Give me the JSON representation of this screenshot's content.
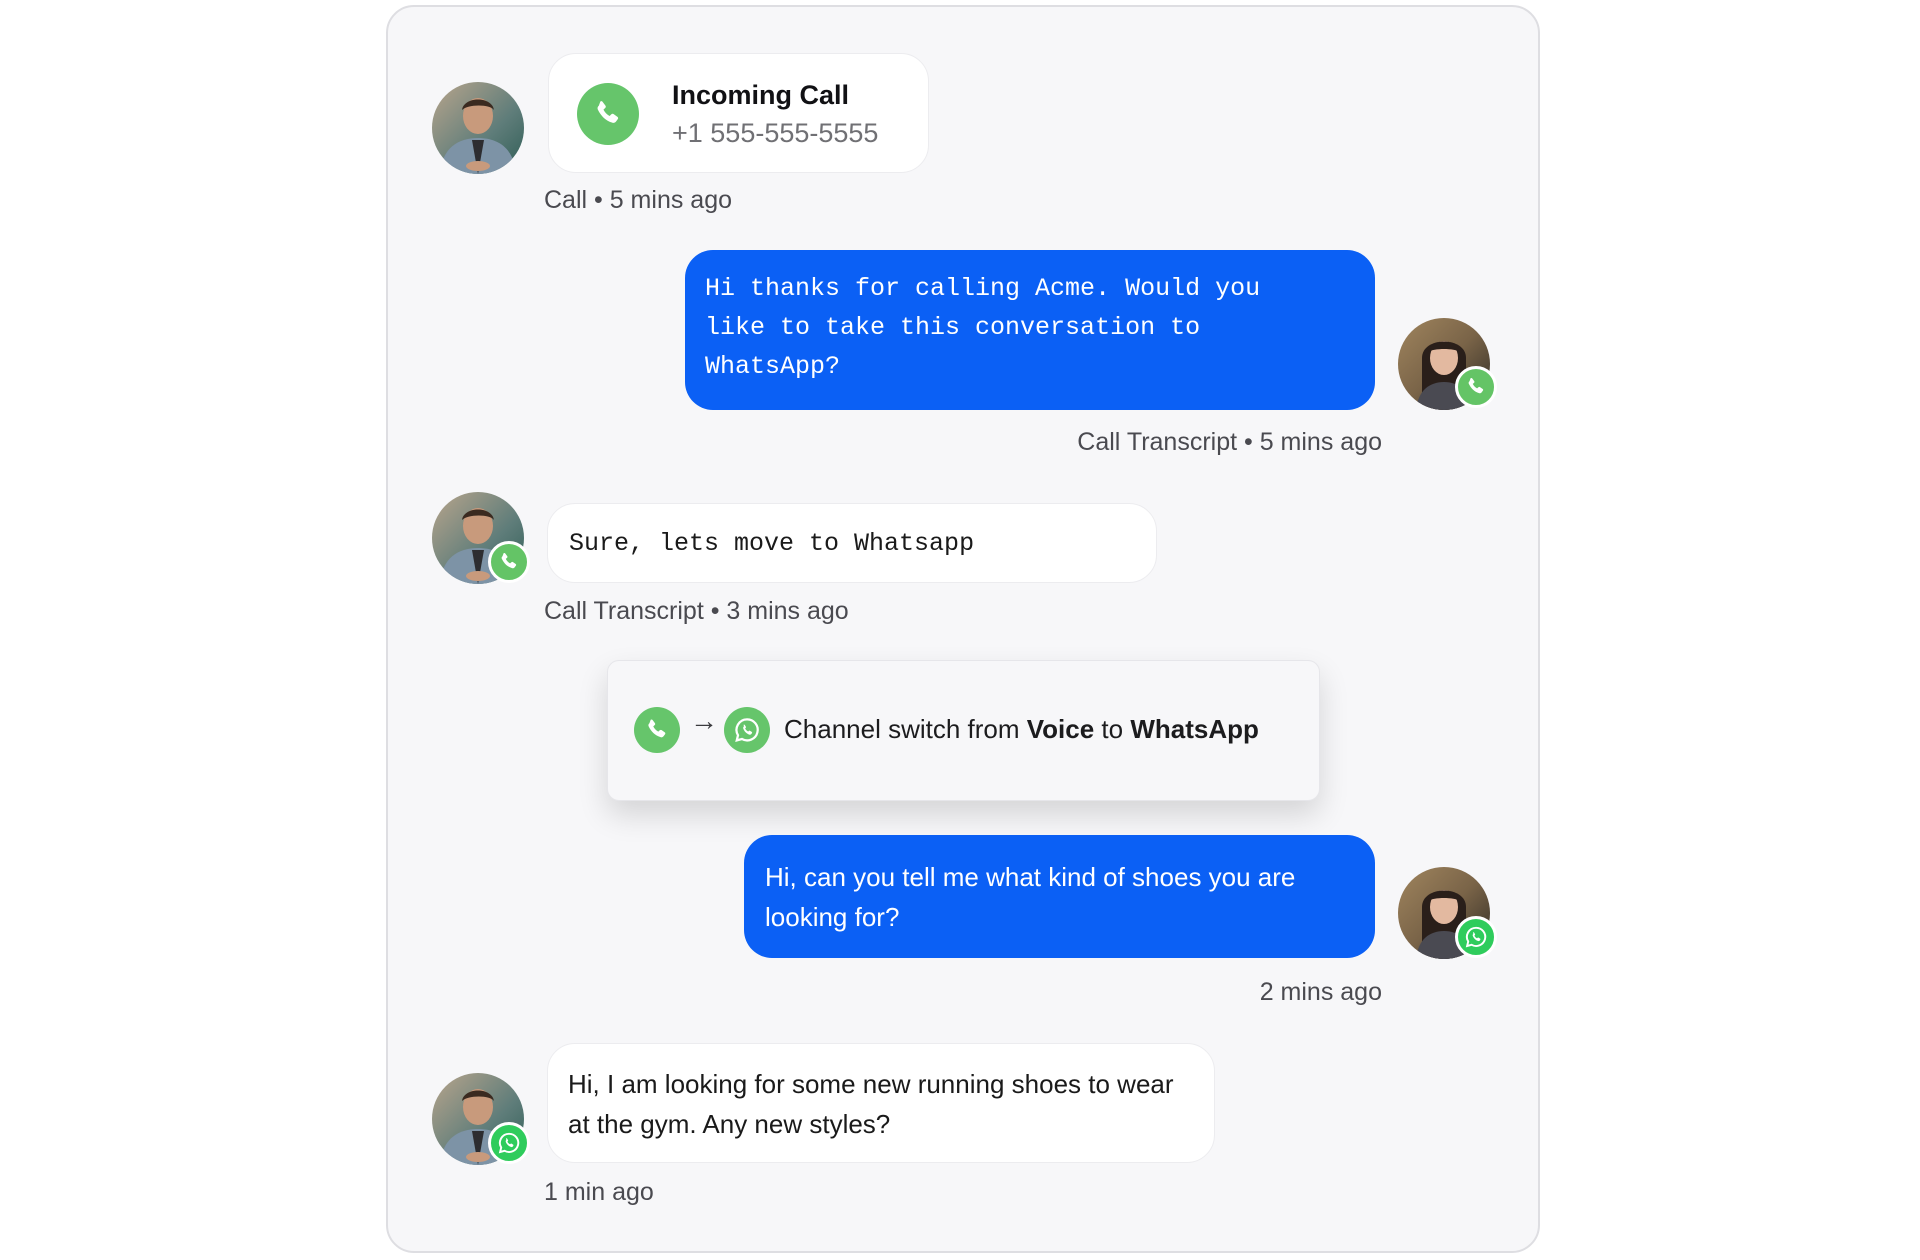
{
  "colors": {
    "accent_blue": "#0b60f5",
    "call_green": "#66c56b",
    "whatsapp_green": "#2fcc5c",
    "card_bg": "#f7f7f9"
  },
  "messages": [
    {
      "type": "incoming_call",
      "sender": "customer",
      "avatar": "male-avatar",
      "title": "Incoming Call",
      "phone": "+1 555-555-5555",
      "icon": "phone-icon",
      "meta": "Call • 5 mins ago"
    },
    {
      "type": "outgoing",
      "sender": "agent",
      "avatar": "female-avatar",
      "badge": "phone-icon",
      "text": "Hi thanks for calling Acme. Would you like to take this conversation to WhatsApp?",
      "lines": [
        "Hi thanks for calling Acme. Would you",
        "like to take this conversation to",
        "WhatsApp?"
      ],
      "meta": "Call Transcript • 5 mins ago"
    },
    {
      "type": "incoming",
      "sender": "customer",
      "avatar": "male-avatar",
      "badge": "phone-icon",
      "text": "Sure, lets move to Whatsapp",
      "meta": "Call Transcript • 3 mins ago"
    },
    {
      "type": "channel_switch",
      "from_icon": "phone-icon",
      "to_icon": "whatsapp-icon",
      "prefix": "Channel switch from ",
      "from": "Voice",
      "middle": " to ",
      "to": "WhatsApp"
    },
    {
      "type": "outgoing",
      "sender": "agent",
      "avatar": "female-avatar",
      "badge": "whatsapp-icon",
      "text": "Hi, can you tell me what kind of shoes you are looking for?",
      "meta": "2 mins ago"
    },
    {
      "type": "incoming",
      "sender": "customer",
      "avatar": "male-avatar",
      "badge": "whatsapp-icon",
      "text": "Hi, I am looking for some new running shoes to wear at the gym. Any new styles?",
      "meta": "1 min ago"
    }
  ]
}
